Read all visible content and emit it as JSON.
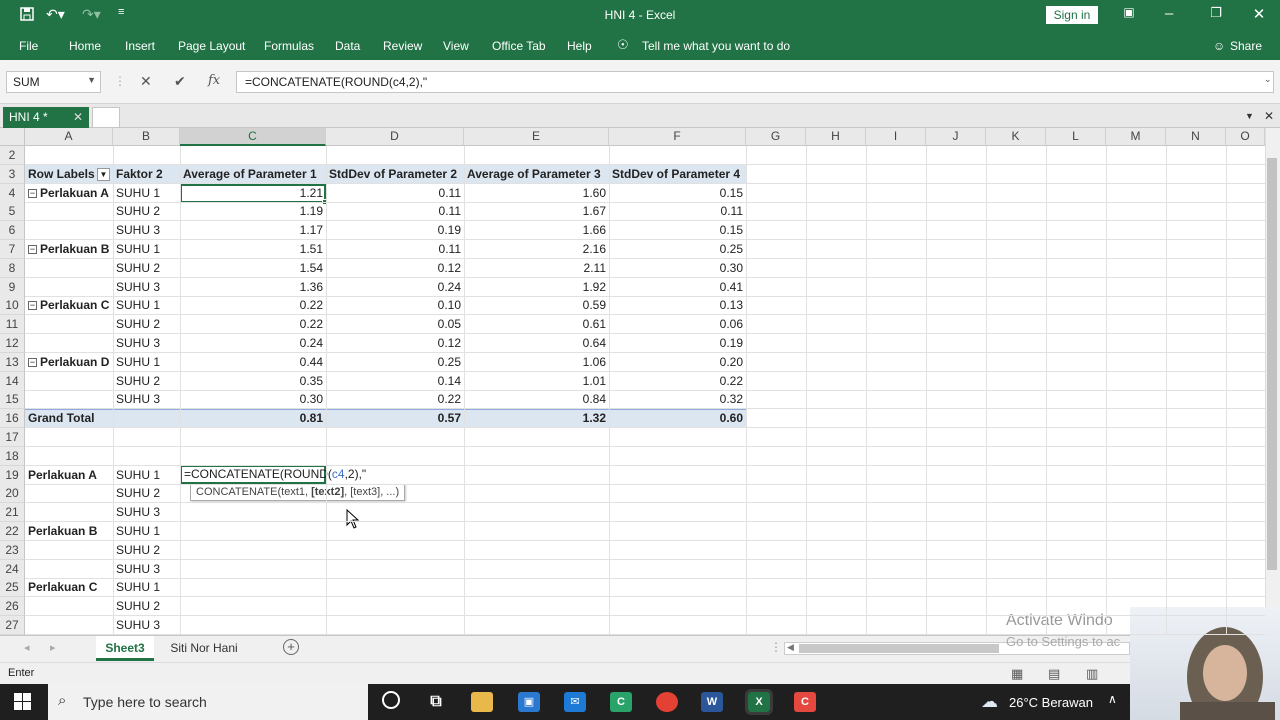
{
  "window": {
    "title": "HNI 4  -  Excel",
    "signin": "Sign in",
    "tell_me": "Tell me what you want to do",
    "share": "Share"
  },
  "ribbon_tabs": [
    "File",
    "Home",
    "Insert",
    "Page Layout",
    "Formulas",
    "Data",
    "Review",
    "View",
    "Office Tab",
    "Help"
  ],
  "formula_bar": {
    "name_box": "SUM",
    "formula": "=CONCATENATE(ROUND(c4,2),\""
  },
  "workbook_tab": "HNI 4 *",
  "columns": [
    "A",
    "B",
    "C",
    "D",
    "E",
    "F",
    "G",
    "H",
    "I",
    "J",
    "K",
    "L",
    "M",
    "N",
    "O"
  ],
  "rows": [
    2,
    3,
    4,
    5,
    6,
    7,
    8,
    9,
    10,
    11,
    12,
    13,
    14,
    15,
    16,
    17,
    18,
    19,
    20,
    21,
    22,
    23,
    24,
    25,
    26,
    27
  ],
  "pivot": {
    "headers": [
      "Row Labels",
      "Faktor 2",
      "Average of Parameter 1",
      "StdDev of Parameter 2",
      "Average of Parameter 3",
      "StdDev of Parameter 4"
    ],
    "groups": [
      {
        "label": "Perlakuan A",
        "rows": [
          [
            "SUHU 1",
            "1.21",
            "0.11",
            "1.60",
            "0.15"
          ],
          [
            "SUHU 2",
            "1.19",
            "0.11",
            "1.67",
            "0.11"
          ],
          [
            "SUHU 3",
            "1.17",
            "0.19",
            "1.66",
            "0.15"
          ]
        ]
      },
      {
        "label": "Perlakuan B",
        "rows": [
          [
            "SUHU 1",
            "1.51",
            "0.11",
            "2.16",
            "0.25"
          ],
          [
            "SUHU 2",
            "1.54",
            "0.12",
            "2.11",
            "0.30"
          ],
          [
            "SUHU 3",
            "1.36",
            "0.24",
            "1.92",
            "0.41"
          ]
        ]
      },
      {
        "label": "Perlakuan C",
        "rows": [
          [
            "SUHU 1",
            "0.22",
            "0.10",
            "0.59",
            "0.13"
          ],
          [
            "SUHU 2",
            "0.22",
            "0.05",
            "0.61",
            "0.06"
          ],
          [
            "SUHU 3",
            "0.24",
            "0.12",
            "0.64",
            "0.19"
          ]
        ]
      },
      {
        "label": "Perlakuan D",
        "rows": [
          [
            "SUHU 1",
            "0.44",
            "0.25",
            "1.06",
            "0.20"
          ],
          [
            "SUHU 2",
            "0.35",
            "0.14",
            "1.01",
            "0.22"
          ],
          [
            "SUHU 3",
            "0.30",
            "0.22",
            "0.84",
            "0.32"
          ]
        ]
      }
    ],
    "grand_total": [
      "Grand Total",
      "0.81",
      "0.57",
      "1.32",
      "0.60"
    ]
  },
  "lower_table": [
    {
      "row": 19,
      "a": "Perlakuan A",
      "b": "SUHU 1"
    },
    {
      "row": 20,
      "a": "",
      "b": "SUHU 2"
    },
    {
      "row": 21,
      "a": "",
      "b": "SUHU 3"
    },
    {
      "row": 22,
      "a": "Perlakuan B",
      "b": "SUHU 1"
    },
    {
      "row": 23,
      "a": "",
      "b": "SUHU 2"
    },
    {
      "row": 24,
      "a": "",
      "b": "SUHU 3"
    },
    {
      "row": 25,
      "a": "Perlakuan C",
      "b": "SUHU 1"
    },
    {
      "row": 26,
      "a": "",
      "b": "SUHU 2"
    },
    {
      "row": 27,
      "a": "",
      "b": "SUHU 3"
    }
  ],
  "edit_cell": {
    "before": "=CONCATENATE(ROUND(",
    "ref": "c4",
    "after": ",2),\""
  },
  "tooltip": {
    "fn": "CONCATENATE(text1, ",
    "bold": "[text2]",
    "rest": ", [text3], ...)"
  },
  "sheets": [
    "Sheet3",
    "Siti Nor Hani"
  ],
  "status": "Enter",
  "watermark": {
    "line1": "Activate Windo",
    "line2": "Go to Settings to ac"
  },
  "taskbar": {
    "search_placeholder": "Type here to search",
    "weather": "26°C  Berawan"
  },
  "colors": {
    "excel_green": "#217346",
    "pivot_fill": "#dce6f1"
  }
}
